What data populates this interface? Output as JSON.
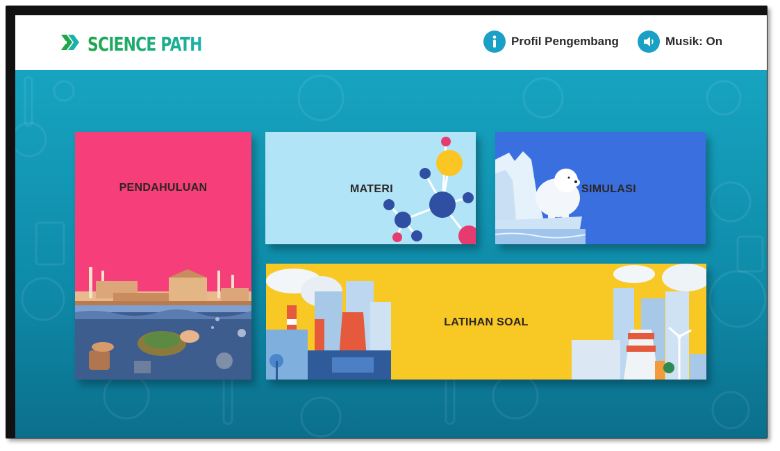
{
  "app": {
    "name": "SCIENCE PATH"
  },
  "header": {
    "profile_label": "Profil Pengembang",
    "music_label": "Musik: On"
  },
  "menu": {
    "pendahuluan": "PENDAHULUAN",
    "materi": "MATERI",
    "simulasi": "SIMULASI",
    "latihan": "LATIHAN SOAL"
  },
  "icons": {
    "logo": "chevron-arrows-logo-icon",
    "profile": "info-icon",
    "music": "speaker-icon"
  },
  "colors": {
    "teal_background": "#0f9bb3",
    "pendahuluan": "#f53e7a",
    "materi": "#b2e4f7",
    "simulasi": "#3a6fe0",
    "latihan": "#f8c825",
    "accent": "#1aa0c4"
  }
}
